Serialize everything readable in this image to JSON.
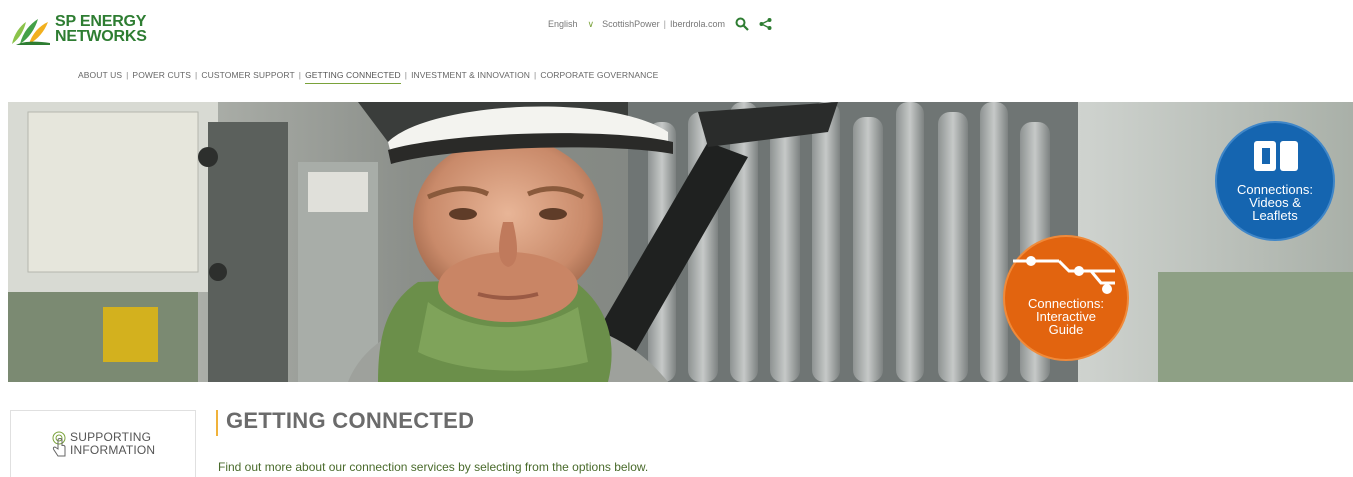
{
  "header": {
    "logo_line1": "SP ENERGY",
    "logo_line2": "NETWORKS",
    "language": "English",
    "links": [
      "ScottishPower",
      "Iberdrola.com"
    ]
  },
  "nav": {
    "items": [
      {
        "label": "ABOUT US"
      },
      {
        "label": "POWER CUTS"
      },
      {
        "label": "CUSTOMER SUPPORT"
      },
      {
        "label": "GETTING CONNECTED",
        "active": true
      },
      {
        "label": "INVESTMENT & INNOVATION"
      },
      {
        "label": "CORPORATE GOVERNANCE"
      }
    ]
  },
  "hero": {
    "badges": [
      {
        "label_lines": [
          "Connections:",
          "Interactive",
          "Guide"
        ],
        "color": "#e2640f"
      },
      {
        "label_lines": [
          "Connections:",
          "Videos &",
          "Leaflets"
        ],
        "color": "#1565b0"
      }
    ]
  },
  "sidebar": {
    "label_line1": "SUPPORTING",
    "label_line2": "INFORMATION"
  },
  "main": {
    "title": "GETTING CONNECTED",
    "intro": "Find out more about our connection services by selecting from the options below."
  },
  "colors": {
    "brand_green": "#2e7d32",
    "accent_green": "#7aa23a",
    "title_accent": "#f0b23a"
  }
}
